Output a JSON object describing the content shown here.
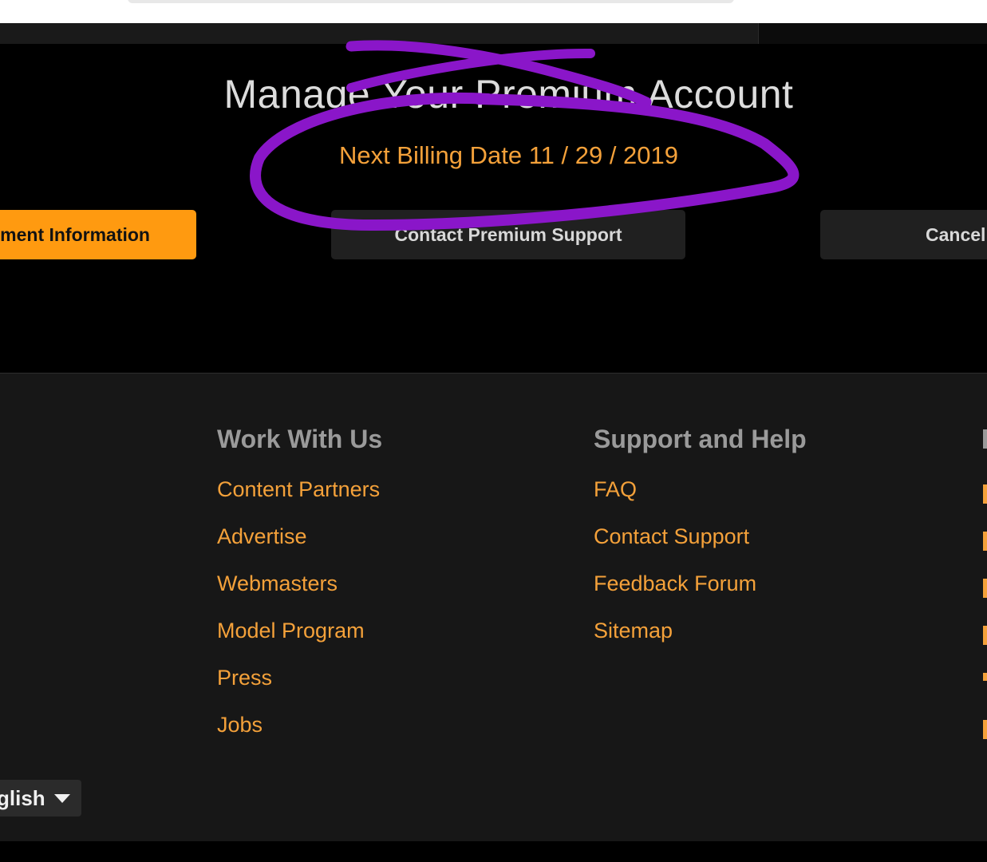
{
  "manage": {
    "title": "Manage Your Premium Account",
    "billing_label": "Next Billing Date 11 / 29 / 2019",
    "buttons": {
      "payment": "ment Information",
      "support": "Contact Premium Support",
      "cancel": "Cancel"
    }
  },
  "footer": {
    "work_with_us": {
      "heading": "Work With Us",
      "links": [
        "Content Partners",
        "Advertise",
        "Webmasters",
        "Model Program",
        "Press",
        "Jobs"
      ]
    },
    "support": {
      "heading": "Support and Help",
      "links": [
        "FAQ",
        "Contact Support",
        "Feedback Forum",
        "Sitemap"
      ]
    },
    "language": "glish"
  },
  "colors": {
    "accent": "#ff9a10",
    "link": "#f4a13a",
    "annotation": "#8a16c9",
    "background": "#000000",
    "footer_bg": "#171717"
  },
  "icons": {
    "language_caret": "caret-down-icon"
  }
}
